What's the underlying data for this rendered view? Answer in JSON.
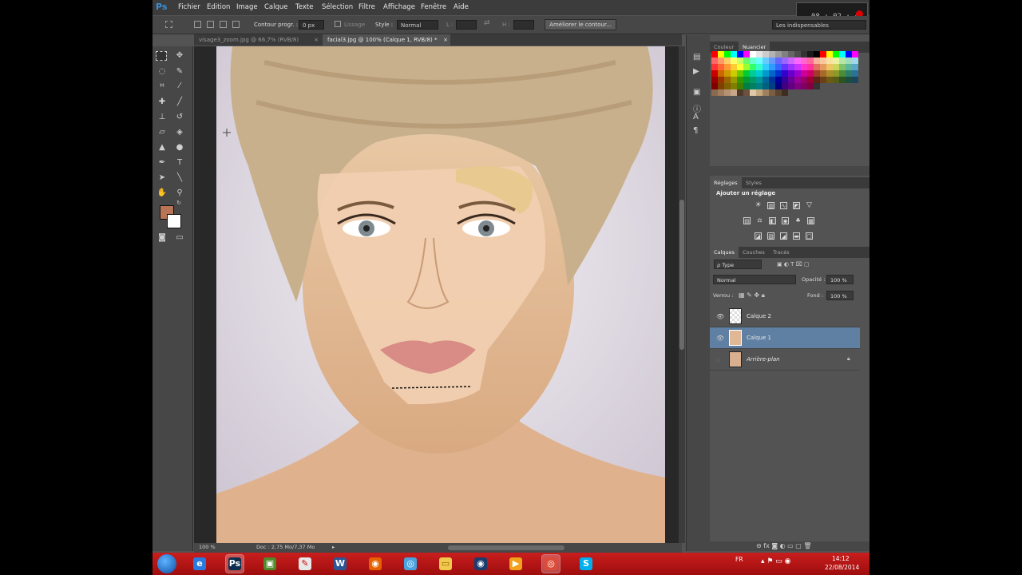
{
  "app": {
    "logo": "Ps"
  },
  "menu": [
    "Fichier",
    "Edition",
    "Image",
    "Calque",
    "Texte",
    "Sélection",
    "Filtre",
    "Affichage",
    "Fenêtre",
    "Aide"
  ],
  "recorder": {
    "time": "08 : 02 : 41"
  },
  "options": {
    "contour_label": "Contour progr. :",
    "contour_value": "0 px",
    "lissage": "Lissage",
    "style_label": "Style :",
    "style_value": "Normal",
    "w_label": "L :",
    "h_label": "H :",
    "refine_button": "Améliorer le contour...",
    "workspace": "Les indispensables"
  },
  "tabs": [
    {
      "label": "visage3_zoom.jpg @ 66,7% (RVB/8)",
      "close": "×"
    },
    {
      "label": "facial3.jpg @ 100% (Calque 1, RVB/8) *",
      "close": "×"
    }
  ],
  "status": {
    "zoom": "100 %",
    "doc": "Doc : 2,75 Mo/7,37 Mo"
  },
  "colors": {
    "foreground": "#b87455",
    "background": "#ffffff"
  },
  "panels": {
    "swatch_tabs": [
      "Couleur",
      "Nuancier"
    ],
    "adjust_tabs": [
      "Réglages",
      "Styles"
    ],
    "adjust_title": "Ajouter un réglage",
    "layer_tabs": [
      "Calques",
      "Couches",
      "Tracés"
    ],
    "kind_filter": "ρ Type",
    "blend_mode": "Normal",
    "opacity_label": "Opacité :",
    "opacity_value": "100 %",
    "lock_label": "Verrou :",
    "fill_label": "Fond :",
    "fill_value": "100 %"
  },
  "layers": [
    {
      "name": "Calque 2",
      "visible": true,
      "selected": false
    },
    {
      "name": "Calque 1",
      "visible": true,
      "selected": true
    },
    {
      "name": "Arrière-plan",
      "visible": false,
      "selected": false,
      "locked": true
    }
  ],
  "taskbar": {
    "apps": [
      "ie-icon",
      "photoshop-icon",
      "minecraft-icon",
      "paint-icon",
      "word-icon",
      "firefox-icon",
      "network-icon",
      "folder-icon",
      "media-icon",
      "video-icon",
      "chrome-icon",
      "skype-icon"
    ],
    "lang": "FR",
    "time": "14:12",
    "date": "22/08/2014"
  }
}
